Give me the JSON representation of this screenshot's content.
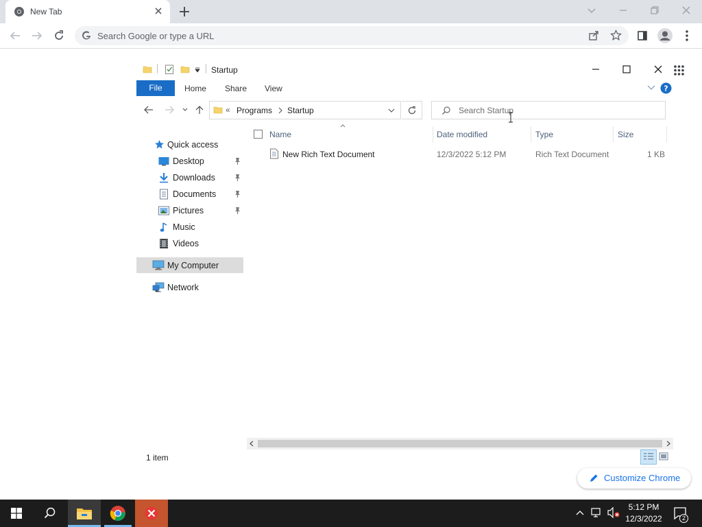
{
  "browser": {
    "tab_title": "New Tab",
    "omnibox_placeholder": "Search Google or type a URL",
    "customize_label": "Customize Chrome"
  },
  "explorer": {
    "title": "Startup",
    "ribbon_tabs": [
      "File",
      "Home",
      "Share",
      "View"
    ],
    "breadcrumb": {
      "overflow": "«",
      "items": [
        "Programs",
        "Startup"
      ]
    },
    "search_placeholder": "Search Startup",
    "nav": {
      "quick_access": "Quick access",
      "items": [
        {
          "label": "Desktop",
          "pinned": true,
          "icon": "desktop-icon"
        },
        {
          "label": "Downloads",
          "pinned": true,
          "icon": "downloads-icon"
        },
        {
          "label": "Documents",
          "pinned": true,
          "icon": "documents-icon"
        },
        {
          "label": "Pictures",
          "pinned": true,
          "icon": "pictures-icon"
        },
        {
          "label": "Music",
          "pinned": false,
          "icon": "music-icon"
        },
        {
          "label": "Videos",
          "pinned": false,
          "icon": "videos-icon"
        }
      ],
      "my_computer": "My Computer",
      "network": "Network"
    },
    "columns": {
      "name": "Name",
      "date": "Date modified",
      "type": "Type",
      "size": "Size"
    },
    "files": [
      {
        "name": "New Rich Text Document",
        "date": "12/3/2022 5:12 PM",
        "type": "Rich Text Document",
        "size": "1 KB"
      }
    ],
    "status": "1 item"
  },
  "taskbar": {
    "time": "5:12 PM",
    "date": "12/3/2022",
    "notification_count": "2"
  },
  "colors": {
    "accent": "#1a6dc6",
    "taskbar": "#1c1c1c",
    "chrome_frame": "#dee1e6",
    "link": "#1a73e8"
  }
}
